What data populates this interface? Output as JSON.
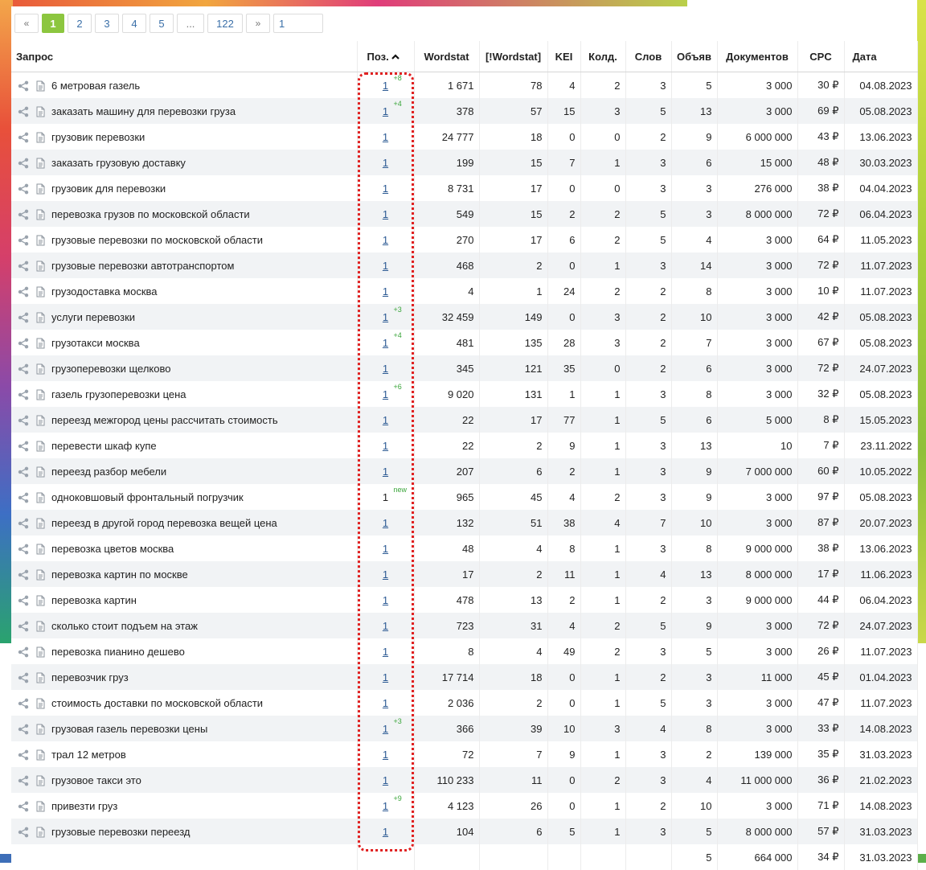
{
  "pagination": {
    "prev": "«",
    "pages": [
      "1",
      "2",
      "3",
      "4",
      "5"
    ],
    "active": "1",
    "dots": "...",
    "last": "122",
    "next": "»",
    "input_value": "1"
  },
  "columns": {
    "query": "Запрос",
    "pos": "Поз.",
    "wordstat": "Wordstat",
    "wordstat_exact": "[!Wordstat]",
    "kei": "KEI",
    "kold": "Колд.",
    "words": "Слов",
    "volume": "Объяв",
    "docs": "Документов",
    "cpc": "CPC",
    "date": "Дата"
  },
  "colors": {
    "accent": "#8cc63f",
    "link": "#2c5a93",
    "delta": "#3aa53a",
    "highlight": "#e02020"
  },
  "icons": {
    "share": "share-icon",
    "doc": "document-icon",
    "sort": "sort-up-icon"
  },
  "rows": [
    {
      "query": "6 метровая газель",
      "pos": "1",
      "delta": "+8",
      "ws": "1 671",
      "wse": "78",
      "kei": "4",
      "kold": "2",
      "words": "3",
      "vol": "5",
      "docs": "3 000",
      "cpc": "30 ₽",
      "date": "04.08.2023"
    },
    {
      "query": "заказать машину для перевозки груза",
      "pos": "1",
      "delta": "+4",
      "ws": "378",
      "wse": "57",
      "kei": "15",
      "kold": "3",
      "words": "5",
      "vol": "13",
      "docs": "3 000",
      "cpc": "69 ₽",
      "date": "05.08.2023"
    },
    {
      "query": "грузовик перевозки",
      "pos": "1",
      "delta": "",
      "ws": "24 777",
      "wse": "18",
      "kei": "0",
      "kold": "0",
      "words": "2",
      "vol": "9",
      "docs": "6 000 000",
      "cpc": "43 ₽",
      "date": "13.06.2023"
    },
    {
      "query": "заказать грузовую доставку",
      "pos": "1",
      "delta": "",
      "ws": "199",
      "wse": "15",
      "kei": "7",
      "kold": "1",
      "words": "3",
      "vol": "6",
      "docs": "15 000",
      "cpc": "48 ₽",
      "date": "30.03.2023"
    },
    {
      "query": "грузовик для перевозки",
      "pos": "1",
      "delta": "",
      "ws": "8 731",
      "wse": "17",
      "kei": "0",
      "kold": "0",
      "words": "3",
      "vol": "3",
      "docs": "276 000",
      "cpc": "38 ₽",
      "date": "04.04.2023"
    },
    {
      "query": "перевозка грузов по московской области",
      "pos": "1",
      "delta": "",
      "ws": "549",
      "wse": "15",
      "kei": "2",
      "kold": "2",
      "words": "5",
      "vol": "3",
      "docs": "8 000 000",
      "cpc": "72 ₽",
      "date": "06.04.2023"
    },
    {
      "query": "грузовые перевозки по московской области",
      "pos": "1",
      "delta": "",
      "ws": "270",
      "wse": "17",
      "kei": "6",
      "kold": "2",
      "words": "5",
      "vol": "4",
      "docs": "3 000",
      "cpc": "64 ₽",
      "date": "11.05.2023"
    },
    {
      "query": "грузовые перевозки автотранспортом",
      "pos": "1",
      "delta": "",
      "ws": "468",
      "wse": "2",
      "kei": "0",
      "kold": "1",
      "words": "3",
      "vol": "14",
      "docs": "3 000",
      "cpc": "72 ₽",
      "date": "11.07.2023"
    },
    {
      "query": "грузодоставка москва",
      "pos": "1",
      "delta": "",
      "ws": "4",
      "wse": "1",
      "kei": "24",
      "kold": "2",
      "words": "2",
      "vol": "8",
      "docs": "3 000",
      "cpc": "10 ₽",
      "date": "11.07.2023"
    },
    {
      "query": "услуги перевозки",
      "pos": "1",
      "delta": "+3",
      "ws": "32 459",
      "wse": "149",
      "kei": "0",
      "kold": "3",
      "words": "2",
      "vol": "10",
      "docs": "3 000",
      "cpc": "42 ₽",
      "date": "05.08.2023"
    },
    {
      "query": "грузотакси москва",
      "pos": "1",
      "delta": "+4",
      "ws": "481",
      "wse": "135",
      "kei": "28",
      "kold": "3",
      "words": "2",
      "vol": "7",
      "docs": "3 000",
      "cpc": "67 ₽",
      "date": "05.08.2023"
    },
    {
      "query": "грузоперевозки щелково",
      "pos": "1",
      "delta": "",
      "ws": "345",
      "wse": "121",
      "kei": "35",
      "kold": "0",
      "words": "2",
      "vol": "6",
      "docs": "3 000",
      "cpc": "72 ₽",
      "date": "24.07.2023"
    },
    {
      "query": "газель грузоперевозки цена",
      "pos": "1",
      "delta": "+6",
      "ws": "9 020",
      "wse": "131",
      "kei": "1",
      "kold": "1",
      "words": "3",
      "vol": "8",
      "docs": "3 000",
      "cpc": "32 ₽",
      "date": "05.08.2023"
    },
    {
      "query": "переезд межгород цены рассчитать стоимость",
      "pos": "1",
      "delta": "",
      "ws": "22",
      "wse": "17",
      "kei": "77",
      "kold": "1",
      "words": "5",
      "vol": "6",
      "docs": "5 000",
      "cpc": "8 ₽",
      "date": "15.05.2023"
    },
    {
      "query": "перевести шкаф купе",
      "pos": "1",
      "delta": "",
      "ws": "22",
      "wse": "2",
      "kei": "9",
      "kold": "1",
      "words": "3",
      "vol": "13",
      "docs": "10",
      "cpc": "7 ₽",
      "date": "23.11.2022"
    },
    {
      "query": "переезд разбор мебели",
      "pos": "1",
      "delta": "",
      "ws": "207",
      "wse": "6",
      "kei": "2",
      "kold": "1",
      "words": "3",
      "vol": "9",
      "docs": "7 000 000",
      "cpc": "60 ₽",
      "date": "10.05.2022"
    },
    {
      "query": "одноковшовый фронтальный погрузчик",
      "pos": "1",
      "delta": "new",
      "plain": true,
      "ws": "965",
      "wse": "45",
      "kei": "4",
      "kold": "2",
      "words": "3",
      "vol": "9",
      "docs": "3 000",
      "cpc": "97 ₽",
      "date": "05.08.2023"
    },
    {
      "query": "переезд в другой город перевозка вещей цена",
      "pos": "1",
      "delta": "",
      "ws": "132",
      "wse": "51",
      "kei": "38",
      "kold": "4",
      "words": "7",
      "vol": "10",
      "docs": "3 000",
      "cpc": "87 ₽",
      "date": "20.07.2023"
    },
    {
      "query": "перевозка цветов москва",
      "pos": "1",
      "delta": "",
      "ws": "48",
      "wse": "4",
      "kei": "8",
      "kold": "1",
      "words": "3",
      "vol": "8",
      "docs": "9 000 000",
      "cpc": "38 ₽",
      "date": "13.06.2023"
    },
    {
      "query": "перевозка картин по москве",
      "pos": "1",
      "delta": "",
      "ws": "17",
      "wse": "2",
      "kei": "11",
      "kold": "1",
      "words": "4",
      "vol": "13",
      "docs": "8 000 000",
      "cpc": "17 ₽",
      "date": "11.06.2023"
    },
    {
      "query": "перевозка картин",
      "pos": "1",
      "delta": "",
      "ws": "478",
      "wse": "13",
      "kei": "2",
      "kold": "1",
      "words": "2",
      "vol": "3",
      "docs": "9 000 000",
      "cpc": "44 ₽",
      "date": "06.04.2023"
    },
    {
      "query": "сколько стоит подъем на этаж",
      "pos": "1",
      "delta": "",
      "ws": "723",
      "wse": "31",
      "kei": "4",
      "kold": "2",
      "words": "5",
      "vol": "9",
      "docs": "3 000",
      "cpc": "72 ₽",
      "date": "24.07.2023"
    },
    {
      "query": "перевозка пианино дешево",
      "pos": "1",
      "delta": "",
      "ws": "8",
      "wse": "4",
      "kei": "49",
      "kold": "2",
      "words": "3",
      "vol": "5",
      "docs": "3 000",
      "cpc": "26 ₽",
      "date": "11.07.2023"
    },
    {
      "query": "перевозчик груз",
      "pos": "1",
      "delta": "",
      "ws": "17 714",
      "wse": "18",
      "kei": "0",
      "kold": "1",
      "words": "2",
      "vol": "3",
      "docs": "11 000",
      "cpc": "45 ₽",
      "date": "01.04.2023"
    },
    {
      "query": "стоимость доставки по московской области",
      "pos": "1",
      "delta": "",
      "ws": "2 036",
      "wse": "2",
      "kei": "0",
      "kold": "1",
      "words": "5",
      "vol": "3",
      "docs": "3 000",
      "cpc": "47 ₽",
      "date": "11.07.2023"
    },
    {
      "query": "грузовая газель перевозки цены",
      "pos": "1",
      "delta": "+3",
      "ws": "366",
      "wse": "39",
      "kei": "10",
      "kold": "3",
      "words": "4",
      "vol": "8",
      "docs": "3 000",
      "cpc": "33 ₽",
      "date": "14.08.2023"
    },
    {
      "query": "трал 12 метров",
      "pos": "1",
      "delta": "",
      "ws": "72",
      "wse": "7",
      "kei": "9",
      "kold": "1",
      "words": "3",
      "vol": "2",
      "docs": "139 000",
      "cpc": "35 ₽",
      "date": "31.03.2023"
    },
    {
      "query": "грузовое такси это",
      "pos": "1",
      "delta": "",
      "ws": "110 233",
      "wse": "11",
      "kei": "0",
      "kold": "2",
      "words": "3",
      "vol": "4",
      "docs": "11 000 000",
      "cpc": "36 ₽",
      "date": "21.02.2023"
    },
    {
      "query": "привезти груз",
      "pos": "1",
      "delta": "+9",
      "ws": "4 123",
      "wse": "26",
      "kei": "0",
      "kold": "1",
      "words": "2",
      "vol": "10",
      "docs": "3 000",
      "cpc": "71 ₽",
      "date": "14.08.2023"
    },
    {
      "query": "грузовые перевозки переезд",
      "pos": "1",
      "delta": "",
      "ws": "104",
      "wse": "6",
      "kei": "5",
      "kold": "1",
      "words": "3",
      "vol": "5",
      "docs": "8 000 000",
      "cpc": "57 ₽",
      "date": "31.03.2023"
    },
    {
      "query": "",
      "pos": "",
      "delta": "",
      "ws": "",
      "wse": "",
      "kei": "",
      "kold": "",
      "words": "",
      "vol": "5",
      "docs": "664 000",
      "cpc": "34 ₽",
      "date": "31.03.2023"
    }
  ]
}
